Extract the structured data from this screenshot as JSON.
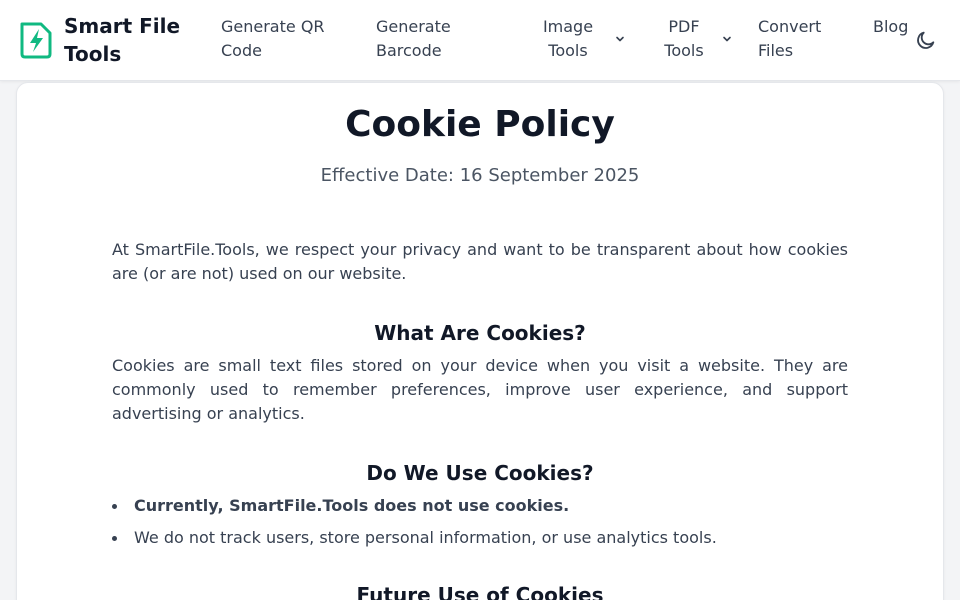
{
  "header": {
    "brand_line1": "Smart File",
    "brand_line2": "Tools",
    "nav": {
      "qr_line1": "Generate QR",
      "qr_line2": "Code",
      "barcode_line1": "Generate",
      "barcode_line2": "Barcode",
      "image_line1": "Image",
      "image_line2": "Tools",
      "pdf_line1": "PDF",
      "pdf_line2": "Tools",
      "convert_line1": "Convert",
      "convert_line2": "Files",
      "blog": "Blog"
    },
    "icons": {
      "logo": "file-bolt-icon",
      "theme": "moon-icon",
      "dropdown": "chevron-down-icon"
    }
  },
  "page": {
    "title": "Cookie Policy",
    "effective_date": "Effective Date: 16 September 2025",
    "intro": "At SmartFile.Tools, we respect your privacy and want to be transparent about how cookies are (or are not) used on our website.",
    "sections": [
      {
        "heading": "What Are Cookies?",
        "text": "Cookies are small text files stored on your device when you visit a website. They are commonly used to remember preferences, improve user experience, and support advertising or analytics."
      },
      {
        "heading": "Do We Use Cookies?",
        "bullets": [
          "Currently, SmartFile.Tools does not use cookies.",
          "We do not track users, store personal information, or use analytics tools."
        ]
      },
      {
        "heading": "Future Use of Cookies"
      }
    ]
  },
  "colors": {
    "accent": "#10b981",
    "heading": "#111827",
    "text": "#374151",
    "muted": "#4b5563",
    "background": "#f3f4f6"
  }
}
